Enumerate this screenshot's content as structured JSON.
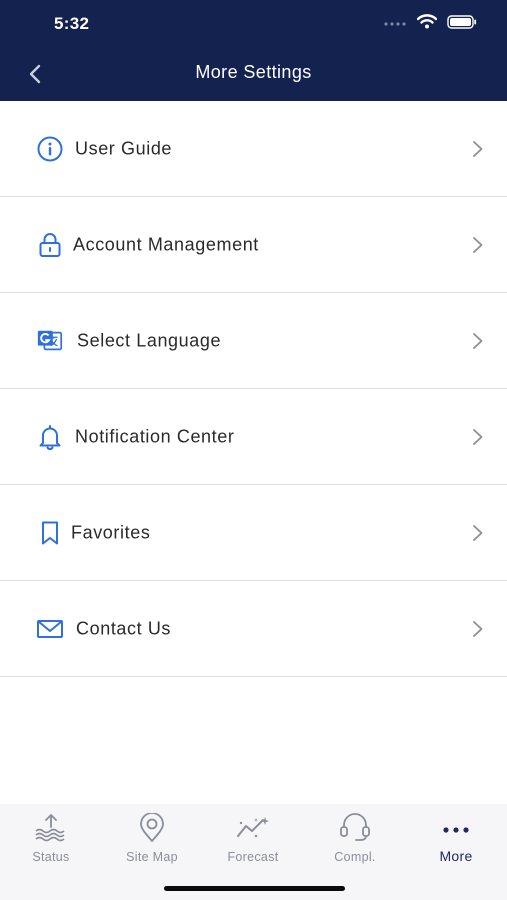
{
  "status_bar": {
    "time": "5:32"
  },
  "nav": {
    "title": "More Settings"
  },
  "menu": {
    "items": [
      {
        "label": "User Guide",
        "icon": "info-icon"
      },
      {
        "label": "Account Management",
        "icon": "lock-icon"
      },
      {
        "label": "Select Language",
        "icon": "translate-icon"
      },
      {
        "label": "Notification Center",
        "icon": "bell-icon"
      },
      {
        "label": "Favorites",
        "icon": "bookmark-icon"
      },
      {
        "label": "Contact Us",
        "icon": "mail-icon"
      }
    ]
  },
  "tabbar": {
    "tabs": [
      {
        "label": "Status",
        "icon": "water-level-icon"
      },
      {
        "label": "Site Map",
        "icon": "map-pin-icon"
      },
      {
        "label": "Forecast",
        "icon": "forecast-icon"
      },
      {
        "label": "Compl.",
        "icon": "headset-icon"
      },
      {
        "label": "More",
        "icon": "more-dots-icon",
        "active": true
      }
    ]
  },
  "colors": {
    "header_bg": "#13224f",
    "icon_blue": "#2f6fe0",
    "active_tab": "#1f2a66",
    "inactive_tab": "#8a8e99"
  }
}
